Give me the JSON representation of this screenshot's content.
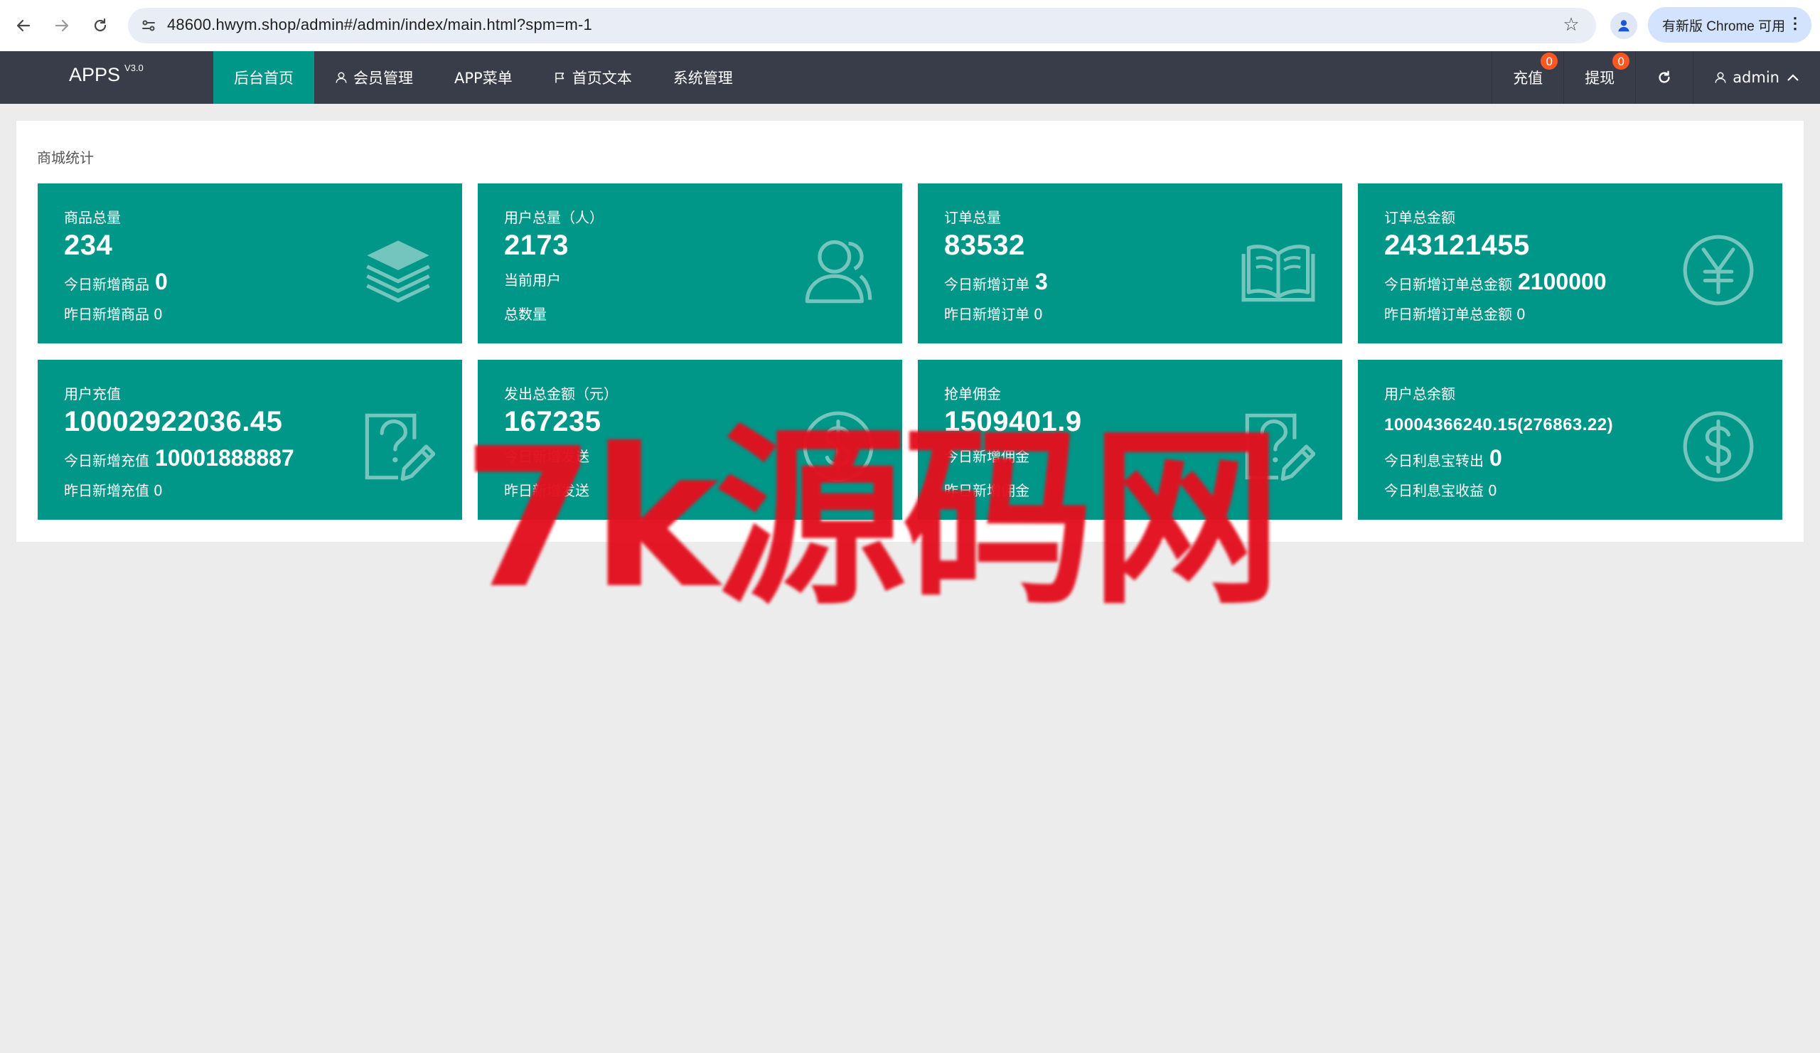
{
  "browser": {
    "url": "48600.hwym.shop/admin#/admin/index/main.html?spm=m-1",
    "update_label": "有新版 Chrome 可用"
  },
  "app": {
    "logo": "APPS",
    "version": "V3.0",
    "menu": [
      {
        "label": "后台首页",
        "icon": "",
        "active": true
      },
      {
        "label": "会员管理",
        "icon": "user-icon",
        "active": false
      },
      {
        "label": "APP菜单",
        "icon": "",
        "active": false
      },
      {
        "label": "首页文本",
        "icon": "flag-icon",
        "active": false
      },
      {
        "label": "系统管理",
        "icon": "",
        "active": false
      }
    ],
    "right": {
      "recharge_label": "充值",
      "recharge_badge": "0",
      "withdraw_label": "提现",
      "withdraw_badge": "0",
      "user_label": "admin"
    },
    "accent_color": "#009688",
    "nav_color": "#393d49"
  },
  "panel": {
    "title": "商城统计",
    "cards": [
      {
        "label": "商品总量",
        "value": "234",
        "line1_label": "今日新增商品",
        "line1_value": "0",
        "line2_label": "昨日新增商品",
        "line2_value": "0",
        "icon": "layers-icon"
      },
      {
        "label": "用户总量（人）",
        "value": "2173",
        "line1_label": "当前用户",
        "line1_value": "",
        "line2_label": "总数量",
        "line2_value": "",
        "icon": "users-icon"
      },
      {
        "label": "订单总量",
        "value": "83532",
        "line1_label": "今日新增订单",
        "line1_value": "3",
        "line2_label": "昨日新增订单",
        "line2_value": "0",
        "icon": "book-icon"
      },
      {
        "label": "订单总金额",
        "value": "243121455",
        "line1_label": "今日新增订单总金额",
        "line1_value": "2100000",
        "line2_label": "昨日新增订单总金额",
        "line2_value": "0",
        "icon": "yen-circle-icon"
      },
      {
        "label": "用户充值",
        "value": "10002922036.45",
        "line1_label": "今日新增充值",
        "line1_value": "10001888887",
        "line2_label": "昨日新增充值",
        "line2_value": "0",
        "icon": "question-edit-icon"
      },
      {
        "label": "发出总金额（元）",
        "value": "167235",
        "line1_label": "今日新增发送",
        "line1_value": "",
        "line2_label": "昨日新增发送",
        "line2_value": "",
        "icon": "dollar-circle-icon"
      },
      {
        "label": "抢单佣金",
        "value": "1509401.9",
        "line1_label": "今日新增佣金",
        "line1_value": "",
        "line2_label": "昨日新增佣金",
        "line2_value": "",
        "icon": "question-edit-icon"
      },
      {
        "label": "用户总余额",
        "value": "10004366240.15(276863.22)",
        "line1_label": "今日利息宝转出",
        "line1_value": "0",
        "line2_label": "今日利息宝收益",
        "line2_value": "0",
        "icon": "dollar-circle-icon"
      }
    ]
  },
  "watermark": "7k源码网"
}
